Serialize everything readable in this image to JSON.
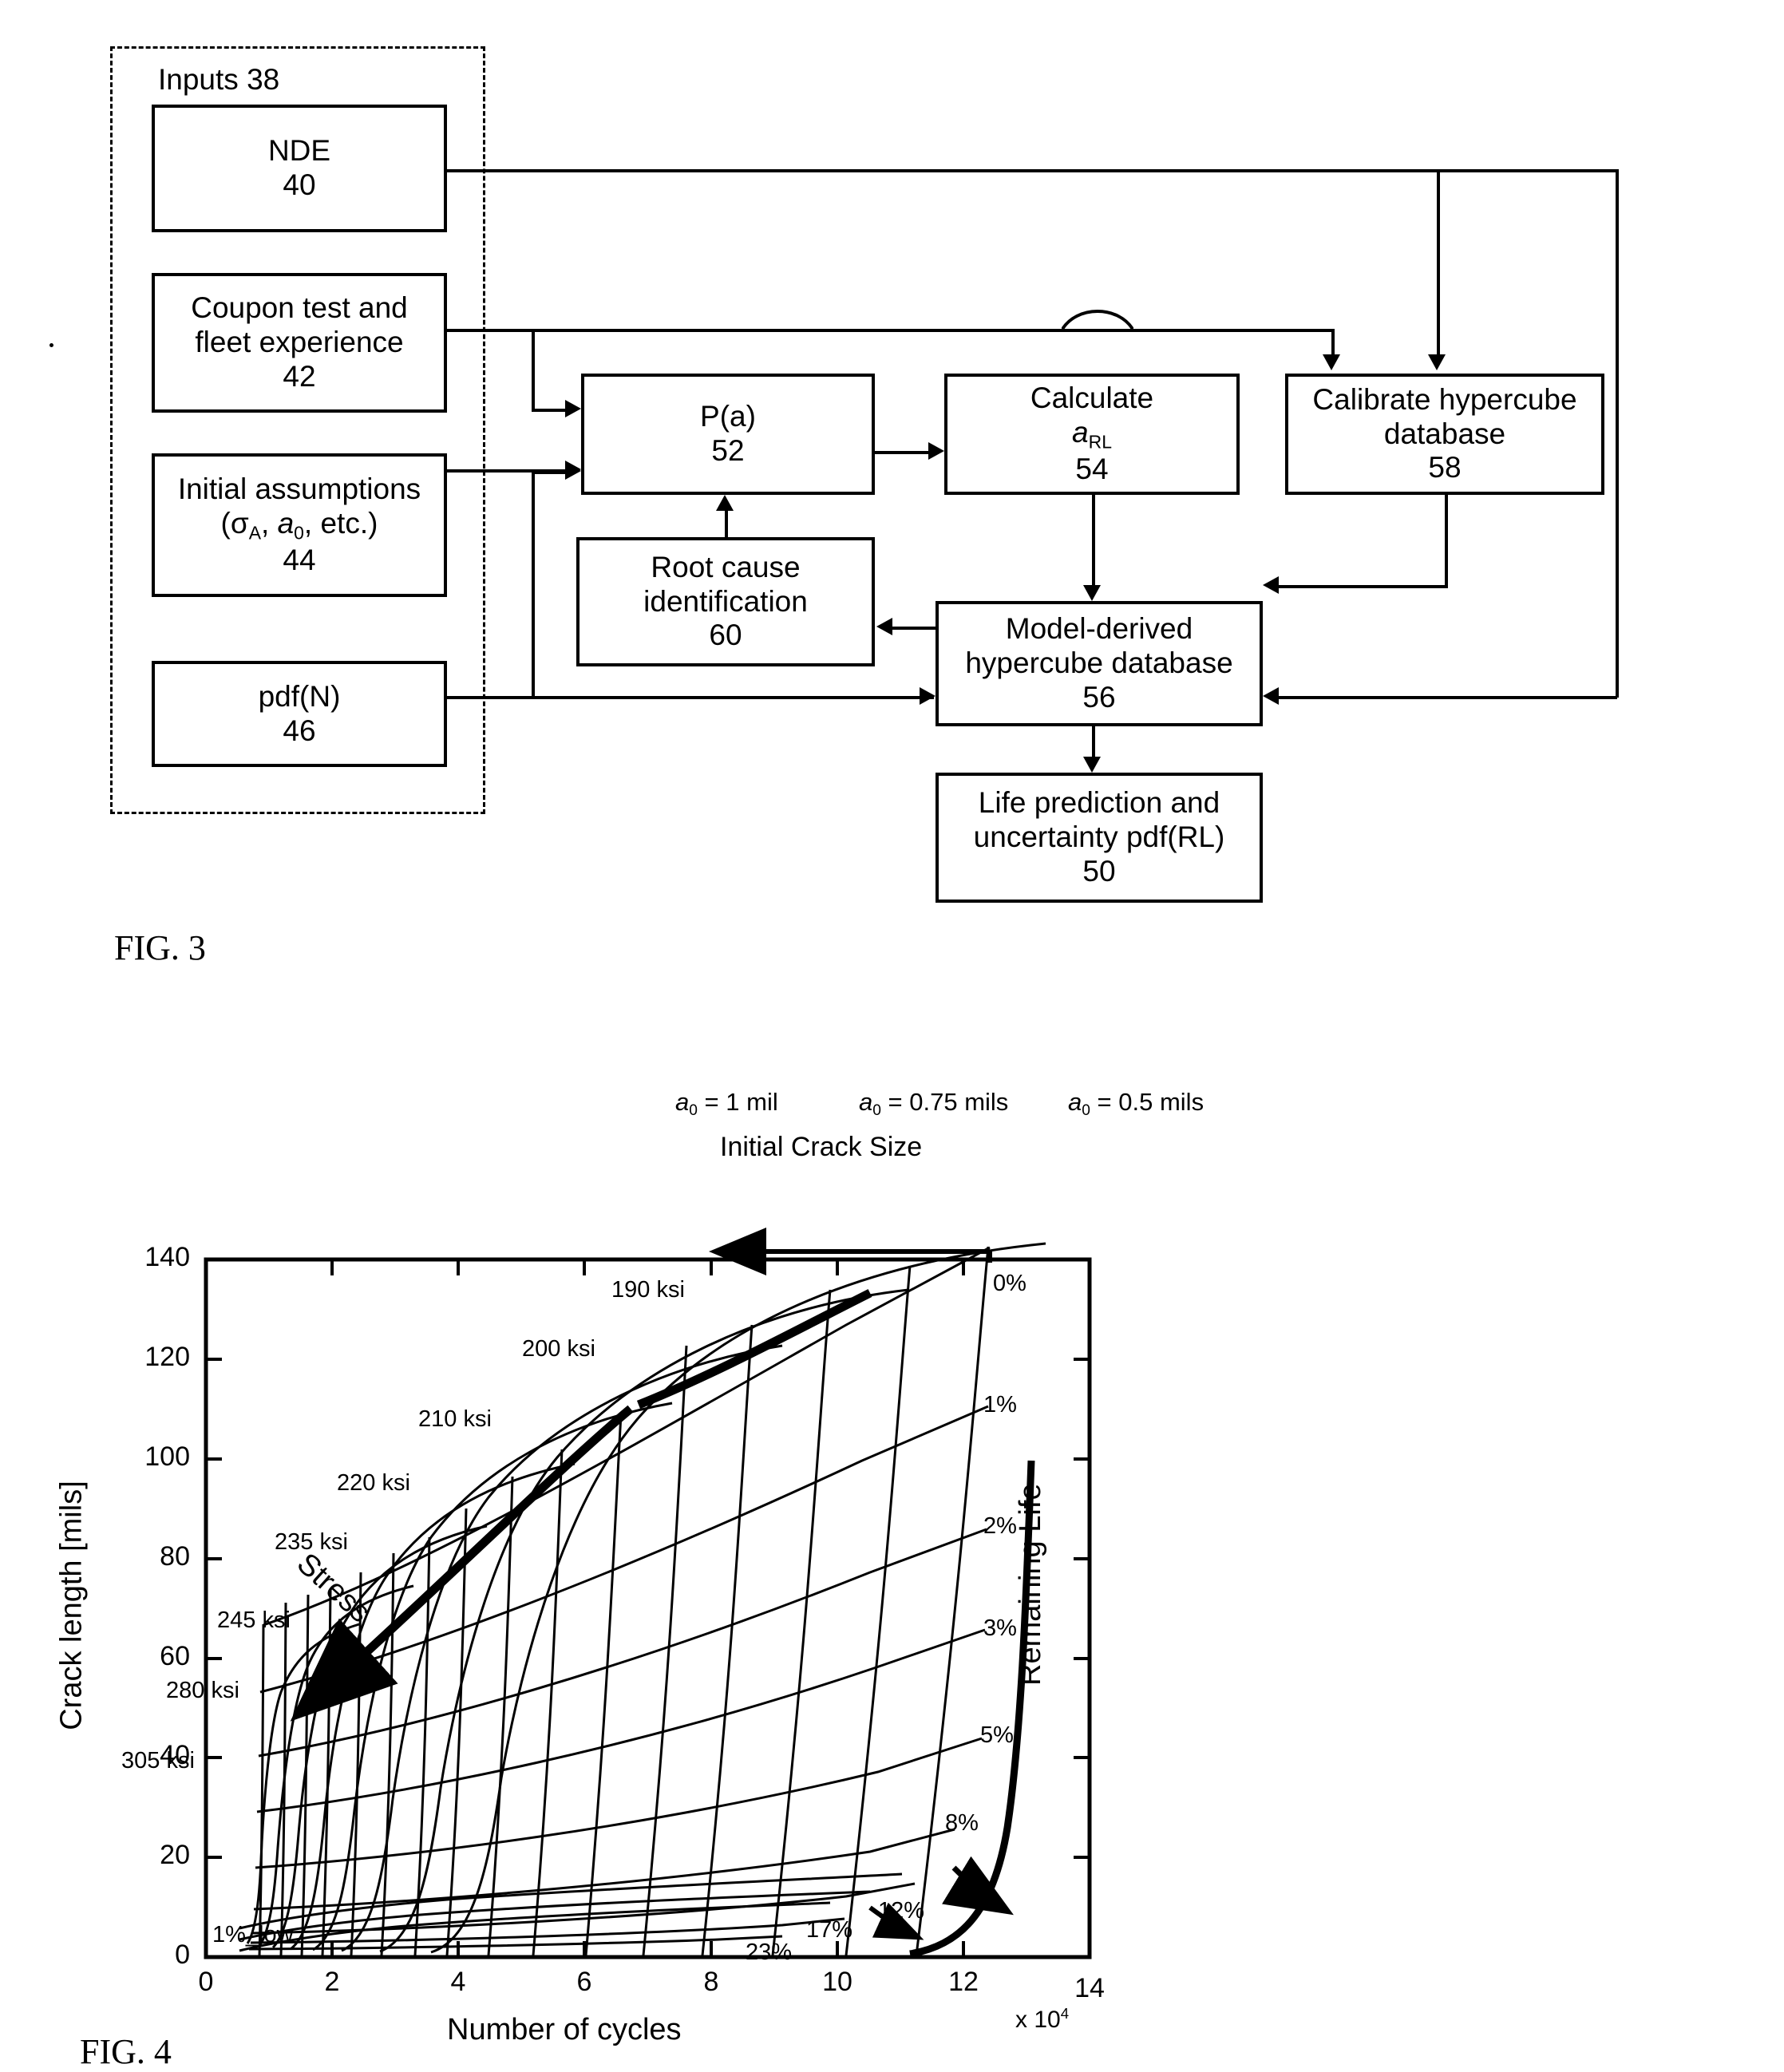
{
  "fig3": {
    "caption": "FIG. 3",
    "group": {
      "label": "Inputs 38"
    },
    "boxes": {
      "nde": {
        "l1": "NDE",
        "l2": "40"
      },
      "coupon": {
        "l1": "Coupon test and",
        "l2": "fleet experience",
        "l3": "42"
      },
      "initial": {
        "l1": "Initial assumptions",
        "l2_pre": "(σ",
        "l2_sub1": "A",
        "l2_mid": ", ",
        "l2_var": "a",
        "l2_sub2": "0",
        "l2_post": ", etc.)",
        "l3": "44"
      },
      "pdfn": {
        "l1": "pdf(N)",
        "l2": "46"
      },
      "pa": {
        "l1": "P(a)",
        "l2": "52"
      },
      "rootcause": {
        "l1": "Root cause",
        "l2": "identification",
        "l3": "60"
      },
      "calculate": {
        "l1": "Calculate",
        "l2_var": "a",
        "l2_sub": "RL",
        "l3": "54"
      },
      "calibrate": {
        "l1": "Calibrate hypercube",
        "l2": "database",
        "l3": "58"
      },
      "modelderived": {
        "l1": "Model-derived",
        "l2": "hypercube database",
        "l3": "56"
      },
      "lifepred": {
        "l1": "Life prediction and",
        "l2": "uncertainty pdf(RL)",
        "l3": "50"
      }
    }
  },
  "fig4": {
    "caption": "FIG. 4",
    "chart_data": {
      "type": "line",
      "title": "",
      "xlabel": "Number of cycles",
      "ylabel": "Crack length [mils]",
      "x_exponent": "x 10",
      "x_exponent_sup": "4",
      "xlim": [
        0,
        14
      ],
      "ylim": [
        0,
        140
      ],
      "xticks": [
        0,
        2,
        4,
        6,
        8,
        10,
        12,
        14
      ],
      "xticklabels": [
        "0",
        "2",
        "4",
        "6",
        "8",
        "10",
        "12",
        "14"
      ],
      "yticks": [
        0,
        20,
        40,
        60,
        80,
        100,
        120,
        140
      ],
      "yticklabels": [
        "0",
        "20",
        "40",
        "60",
        "80",
        "100",
        "120",
        "140"
      ],
      "grid": false,
      "legend_position": "inline-annotations",
      "annotations": {
        "initial_crack_size": {
          "label": "Initial Crack Size",
          "items": [
            "a₀ = 1 mil",
            "a₀ = 0.75 mils",
            "a₀ = 0.5 mils"
          ],
          "items_plain": [
            {
              "v": "a",
              "sub": "0",
              "rest": " = 1 mil"
            },
            {
              "v": "a",
              "sub": "0",
              "rest": " = 0.75 mils"
            },
            {
              "v": "a",
              "sub": "0",
              "rest": " = 0.5 mils"
            }
          ]
        },
        "stress": {
          "label": "Stress",
          "direction": "decreasing-down-left"
        },
        "remaining_life": {
          "label": "Remaining Life",
          "direction": "down-right"
        }
      },
      "stress_series": [
        {
          "name": "190 ksi",
          "value": 190
        },
        {
          "name": "200 ksi",
          "value": 200
        },
        {
          "name": "210 ksi",
          "value": 210
        },
        {
          "name": "220 ksi",
          "value": 220
        },
        {
          "name": "235 ksi",
          "value": 235
        },
        {
          "name": "245 ksi",
          "value": 245
        },
        {
          "name": "280 ksi",
          "value": 280
        },
        {
          "name": "305 ksi",
          "value": 305
        }
      ],
      "remaining_life_contours": [
        {
          "name": "0%",
          "value": 0
        },
        {
          "name": "1%",
          "value": 1
        },
        {
          "name": "2%",
          "value": 2
        },
        {
          "name": "3%",
          "value": 3
        },
        {
          "name": "5%",
          "value": 5
        },
        {
          "name": "8%",
          "value": 8
        },
        {
          "name": "12%",
          "value": 12
        },
        {
          "name": "17%",
          "value": 17
        },
        {
          "name": "23%",
          "value": 23
        },
        {
          "name": "1%_low",
          "value": 1
        }
      ]
    }
  }
}
